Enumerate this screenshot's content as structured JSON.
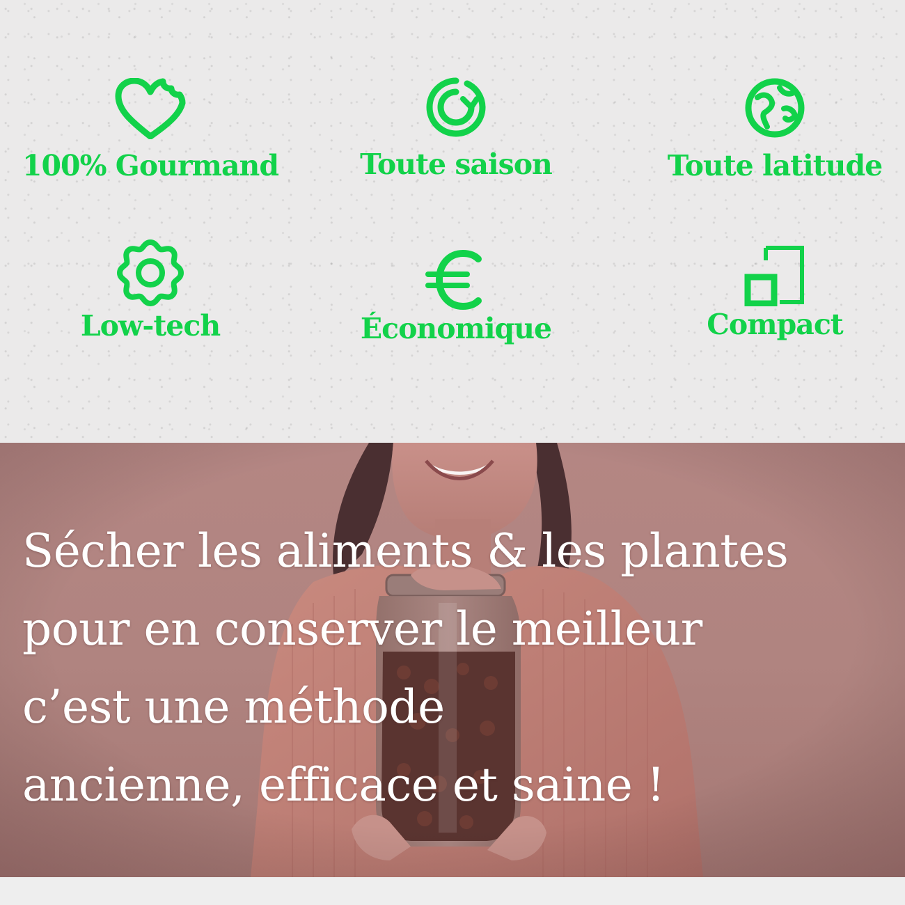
{
  "colors": {
    "accent_green": "#12d24a",
    "hero_overlay": "#b08480",
    "hero_text": "#ffffff",
    "paper": "#ebeaea"
  },
  "features": [
    {
      "label": "100% Gourmand",
      "icon": "bitten-heart-icon"
    },
    {
      "label": "Toute saison",
      "icon": "cycle-arrows-icon"
    },
    {
      "label": "Toute latitude",
      "icon": "globe-icon"
    },
    {
      "label": "Low-tech",
      "icon": "gear-icon"
    },
    {
      "label": "Économique",
      "icon": "euro-icon"
    },
    {
      "label": "Compact",
      "icon": "compact-squares-icon"
    }
  ],
  "hero": {
    "lines": [
      "Sécher les aliments & les plantes",
      "pour en conserver le meilleur",
      "c’est une méthode",
      "ancienne, efficace et saine !"
    ]
  }
}
